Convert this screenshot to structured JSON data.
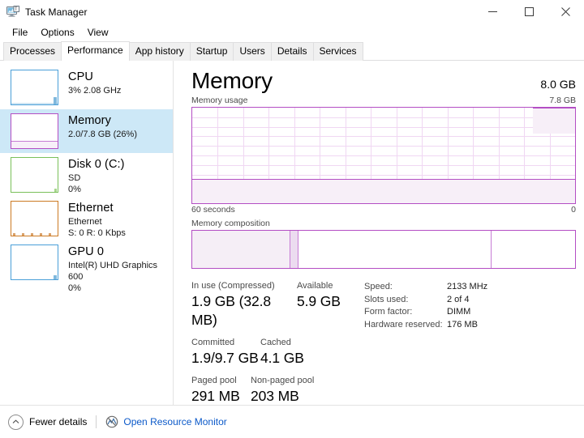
{
  "window": {
    "title": "Task Manager",
    "icon": "task-manager-icon",
    "controls": {
      "minimize": "–",
      "maximize": "☐",
      "close": "✕"
    }
  },
  "menu": {
    "items": [
      "File",
      "Options",
      "View"
    ]
  },
  "tabs": {
    "items": [
      "Processes",
      "Performance",
      "App history",
      "Startup",
      "Users",
      "Details",
      "Services"
    ],
    "active": "Performance"
  },
  "sidebar": {
    "items": [
      {
        "title": "CPU",
        "sub1": "3%  2.08 GHz",
        "sub2": "",
        "color": "#4a9fd8",
        "fill_pct": 3,
        "selected": false
      },
      {
        "title": "Memory",
        "sub1": "2.0/7.8 GB (26%)",
        "sub2": "",
        "color": "#b44ec4",
        "fill_pct": 26,
        "selected": true
      },
      {
        "title": "Disk 0 (C:)",
        "sub1": "SD",
        "sub2": "0%",
        "color": "#79c05a",
        "fill_pct": 0,
        "selected": false
      },
      {
        "title": "Ethernet",
        "sub1": "Ethernet",
        "sub2": "S: 0 R: 0 Kbps",
        "color": "#cc7a23",
        "fill_pct": 0,
        "selected": false
      },
      {
        "title": "GPU 0",
        "sub1": "Intel(R) UHD Graphics 600",
        "sub2": "0%",
        "color": "#4a9fd8",
        "fill_pct": 0,
        "selected": false
      }
    ]
  },
  "main": {
    "title": "Memory",
    "capacity": "8.0 GB",
    "graph_label": "Memory usage",
    "graph_max": "7.8 GB",
    "axis_left": "60 seconds",
    "axis_right": "0",
    "composition_label": "Memory composition"
  },
  "chart_data": {
    "type": "area",
    "title": "Memory usage",
    "ylabel": "",
    "xlabel": "60 seconds",
    "ylim": [
      0,
      7.8
    ],
    "yunit": "GB",
    "xlim": [
      60,
      0
    ],
    "grid": true,
    "series": [
      {
        "name": "In use",
        "color": "#b44ec4",
        "fill": "#f7eff8",
        "values": [
          2.0,
          2.0,
          2.0,
          2.0,
          2.0,
          2.0,
          2.0,
          2.0,
          2.0,
          2.0,
          2.0,
          2.0,
          2.0,
          2.0,
          2.0,
          2.0,
          2.0,
          2.0,
          2.0,
          2.0,
          2.0,
          2.0,
          2.0,
          2.0,
          2.0,
          2.0,
          2.0,
          2.0,
          2.0,
          2.0,
          2.0,
          2.0,
          2.0,
          2.0,
          2.0,
          2.0,
          2.0,
          2.0,
          2.0,
          2.0,
          2.0,
          2.0,
          2.0,
          2.0,
          2.0,
          2.0,
          2.0,
          2.0,
          2.0,
          2.0,
          2.0,
          2.0,
          2.0,
          2.05,
          2.05,
          2.05,
          2.05,
          2.05,
          2.05,
          2.05
        ]
      }
    ],
    "gridlines_vertical": 14,
    "gridlines_horizontal": 9
  },
  "composition": {
    "segments": [
      {
        "name": "in-use",
        "pct": 25.5,
        "fill": "#f5eef6"
      },
      {
        "name": "modified",
        "pct": 2.0,
        "fill": "#ecdcf0"
      },
      {
        "name": "standby",
        "pct": 50.5,
        "fill": "#ffffff"
      },
      {
        "name": "free",
        "pct": 22.0,
        "fill": "#ffffff"
      }
    ]
  },
  "stats": {
    "rows": [
      [
        {
          "label": "In use (Compressed)",
          "value": "1.9 GB (32.8 MB)",
          "width": 130
        },
        {
          "label": "Available",
          "value": "5.9 GB",
          "width": 80
        }
      ],
      [
        {
          "label": "Committed",
          "value": "1.9/9.7 GB",
          "width": 85
        },
        {
          "label": "Cached",
          "value": "4.1 GB",
          "width": 80
        }
      ],
      [
        {
          "label": "Paged pool",
          "value": "291 MB",
          "width": 73
        },
        {
          "label": "Non-paged pool",
          "value": "203 MB",
          "width": 80
        }
      ]
    ]
  },
  "specs": {
    "rows": [
      {
        "label": "Speed:",
        "value": "2133 MHz"
      },
      {
        "label": "Slots used:",
        "value": "2 of 4"
      },
      {
        "label": "Form factor:",
        "value": "DIMM"
      },
      {
        "label": "Hardware reserved:",
        "value": "176 MB"
      }
    ]
  },
  "statusbar": {
    "fewer_details": "Fewer details",
    "open_resource_monitor": "Open Resource Monitor"
  }
}
